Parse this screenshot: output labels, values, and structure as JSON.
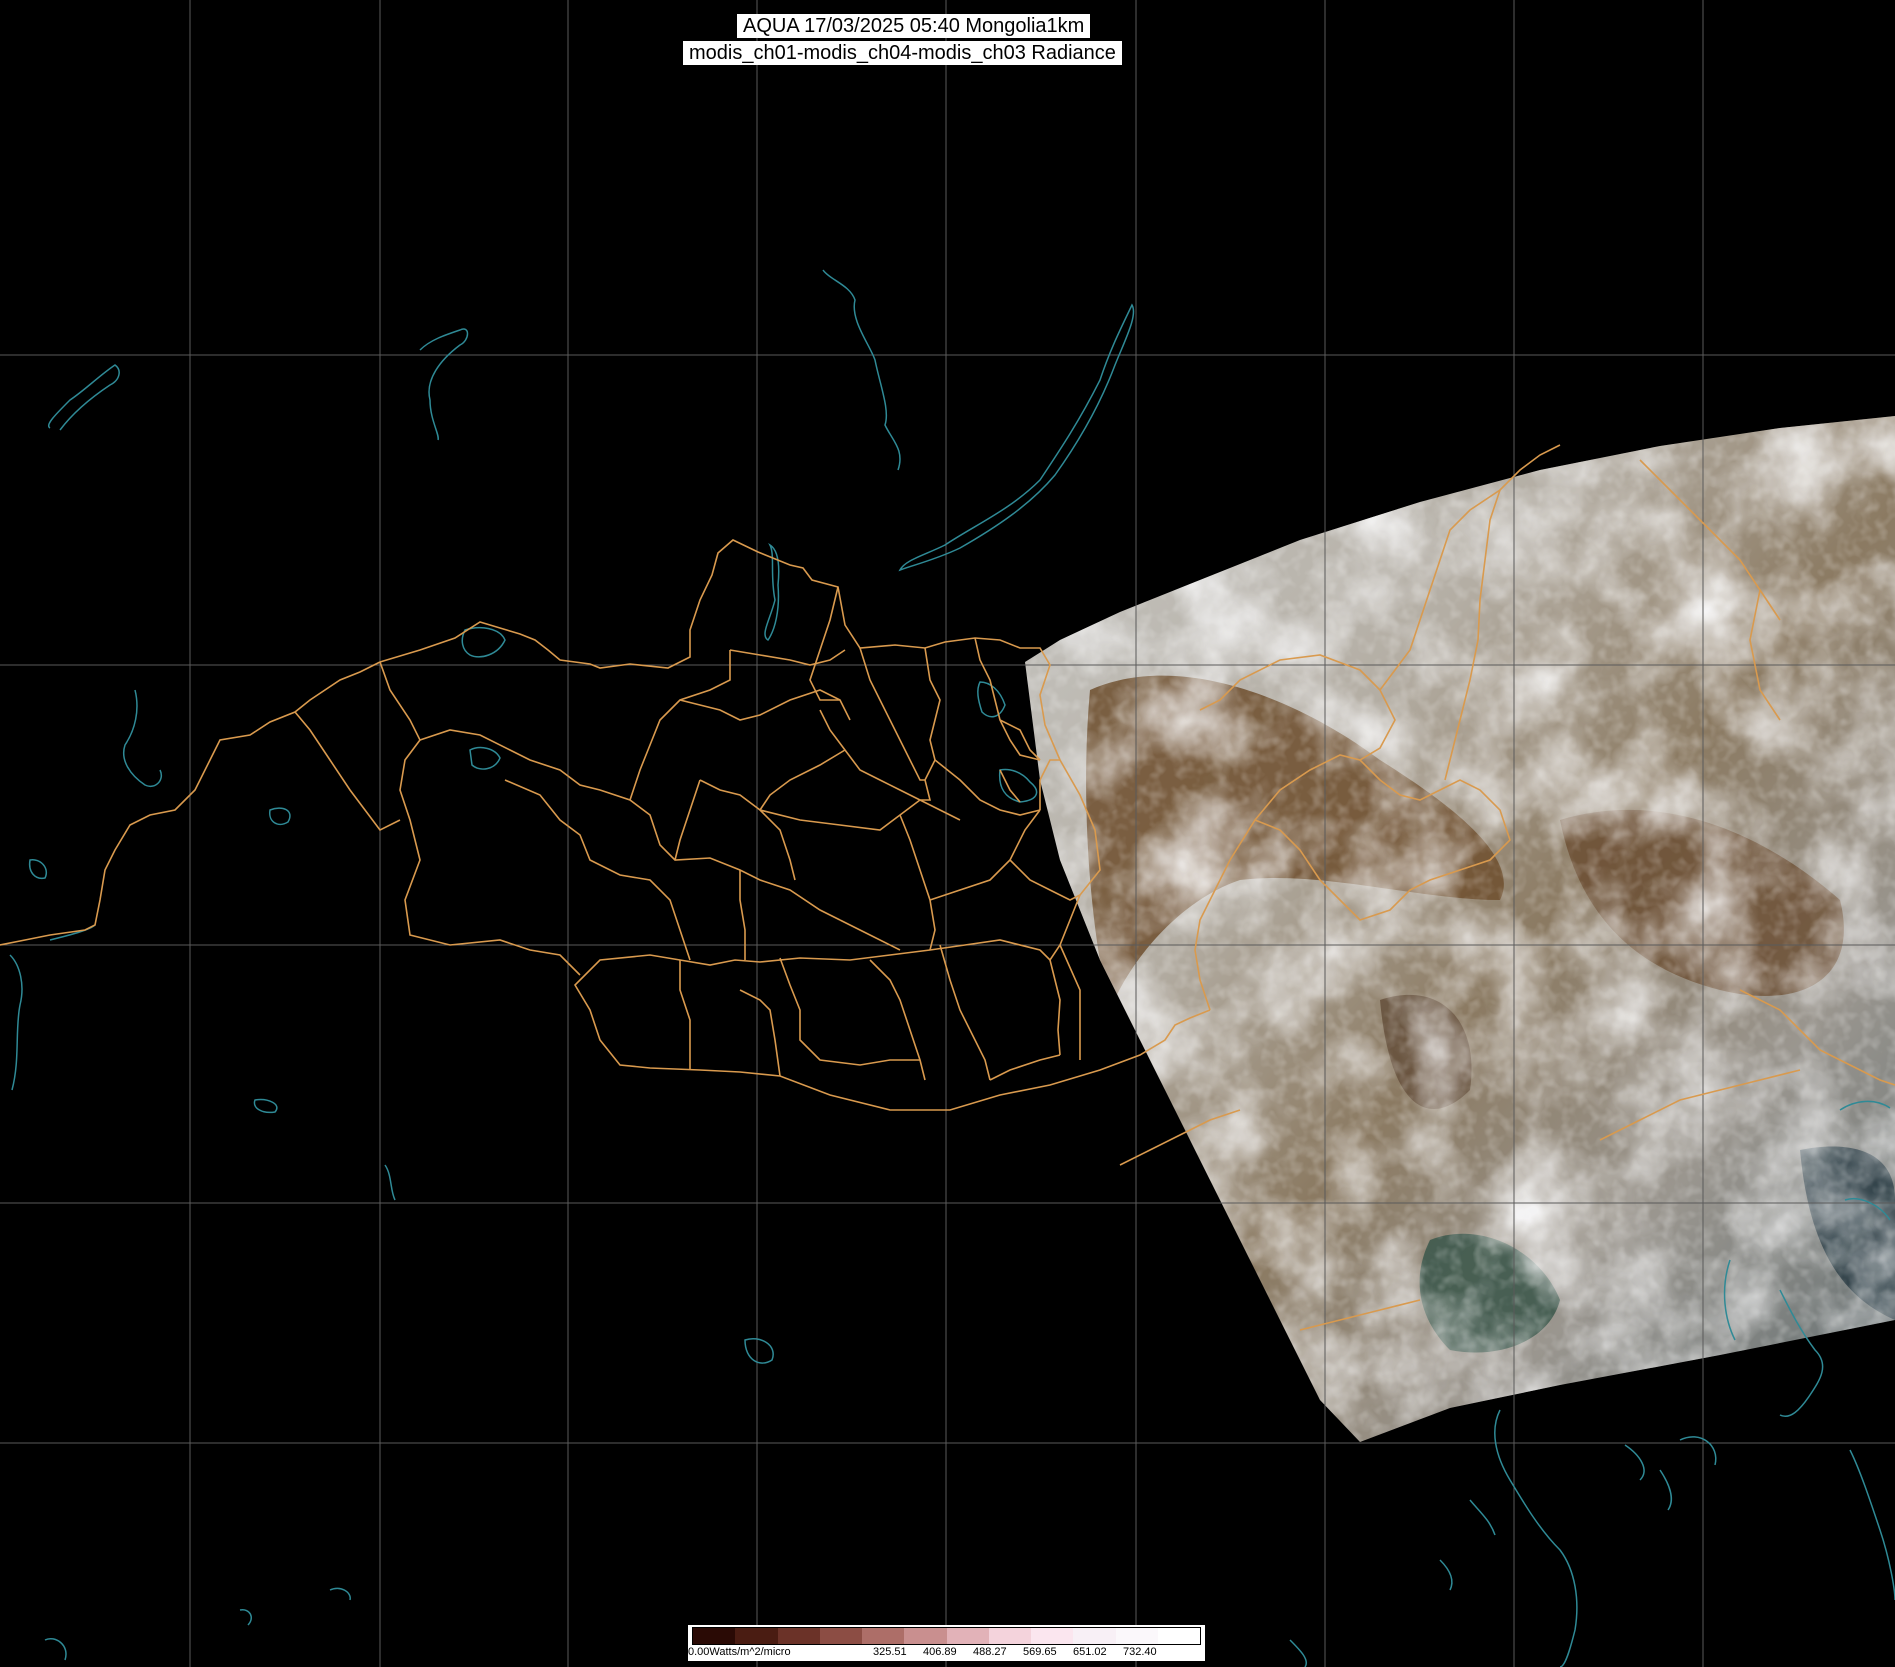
{
  "title": {
    "line1": "AQUA 17/03/2025 05:40 Mongolia1km",
    "line2": "modis_ch01-modis_ch04-modis_ch03 Radiance"
  },
  "colors": {
    "background": "#000000",
    "grid": "#5a5a5a",
    "borders": "#d99a4e",
    "coastlines": "#2f8a96",
    "title_bg": "#ffffff"
  },
  "legend": {
    "unit_label": "0.00Watts/m^2/micro",
    "ticks": [
      "325.51",
      "406.89",
      "488.27",
      "569.65",
      "651.02",
      "732.40"
    ],
    "color_stops": [
      "#2a0a05",
      "#4a1c12",
      "#6b3228",
      "#8c4d44",
      "#ad6e68",
      "#c98f8f",
      "#e2b2b8",
      "#f4d3dc",
      "#fbe6ef",
      "#f8f0f6",
      "#fbf8fb",
      "#ffffff"
    ]
  }
}
